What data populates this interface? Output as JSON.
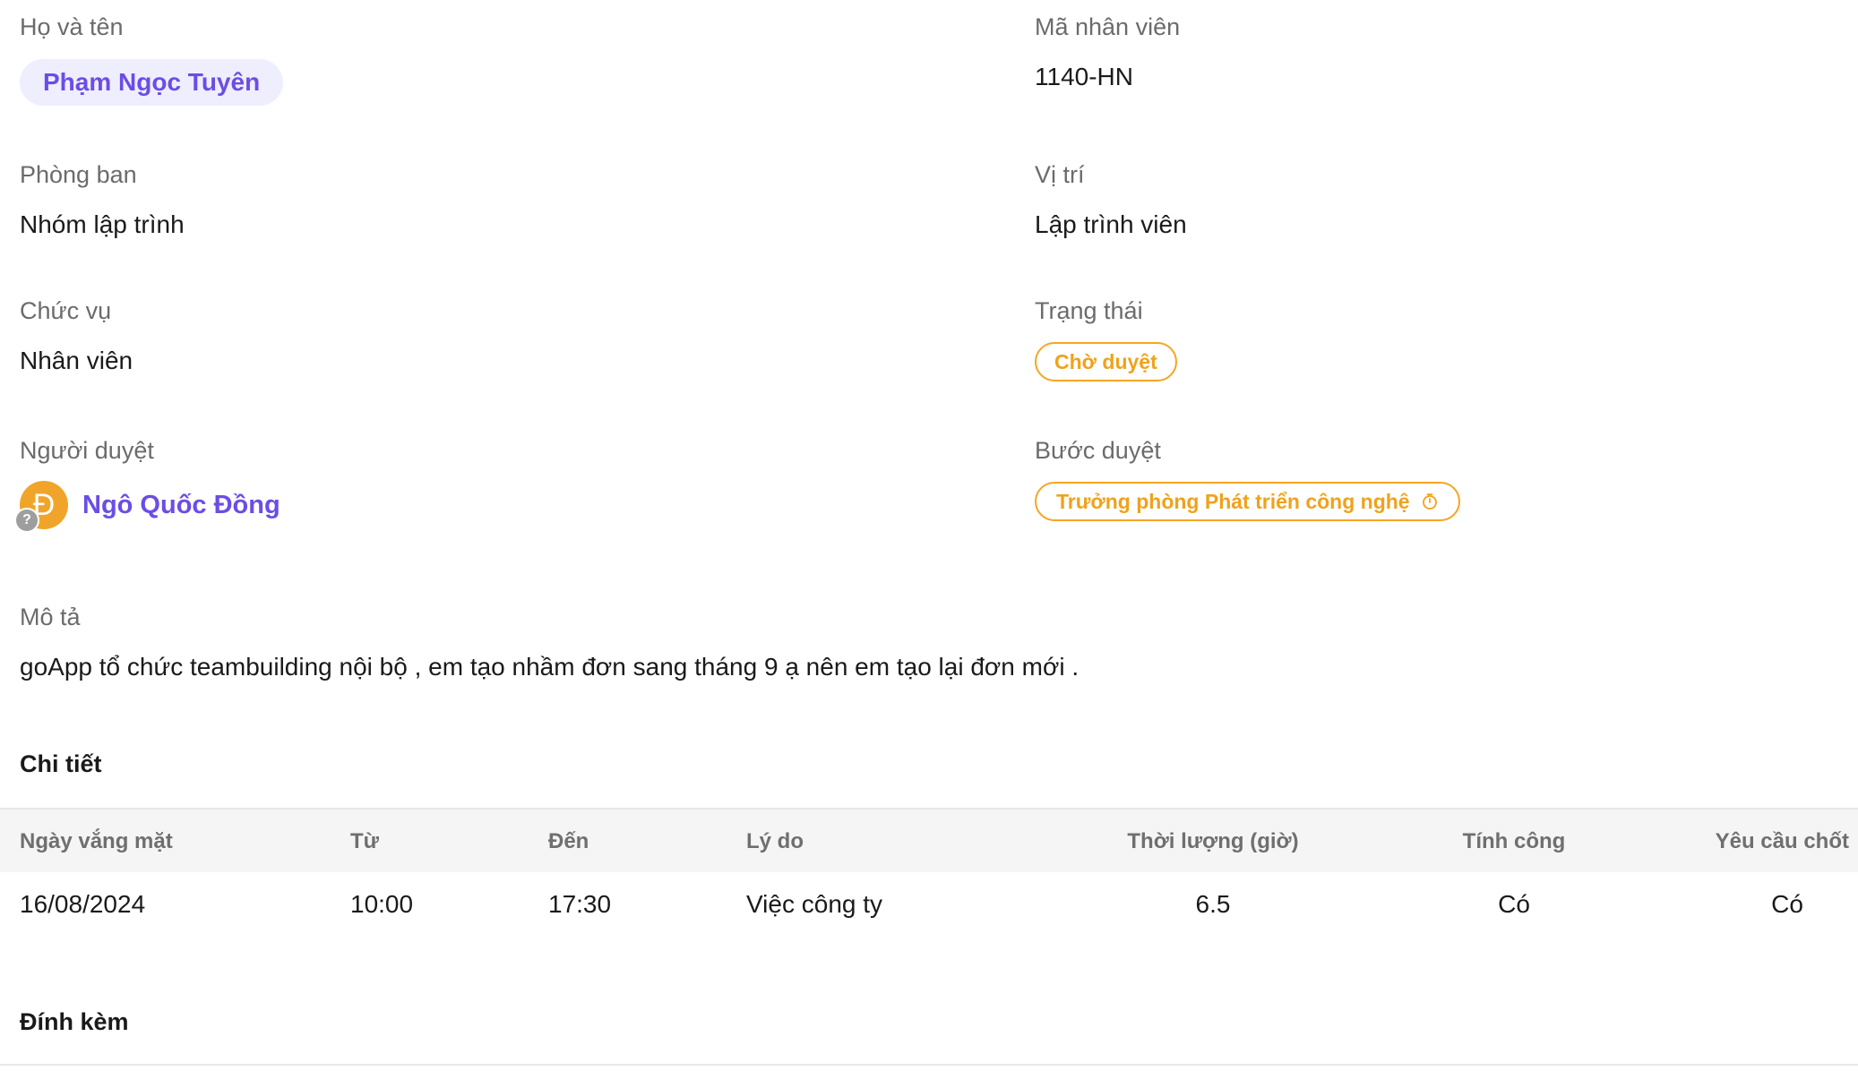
{
  "fields": {
    "full_name": {
      "label": "Họ và tên",
      "value": "Phạm Ngọc Tuyên"
    },
    "employee_code": {
      "label": "Mã nhân viên",
      "value": "1140-HN"
    },
    "department": {
      "label": "Phòng ban",
      "value": "Nhóm lập trình"
    },
    "position": {
      "label": "Vị trí",
      "value": "Lập trình viên"
    },
    "title": {
      "label": "Chức vụ",
      "value": "Nhân viên"
    },
    "status": {
      "label": "Trạng thái",
      "value": "Chờ duyệt"
    },
    "approver": {
      "label": "Người duyệt",
      "value": "Ngô Quốc Đồng",
      "avatar_initial": "Đ",
      "avatar_badge": "?"
    },
    "approval_step": {
      "label": "Bước duyệt",
      "value": "Trưởng phòng Phát triển công nghệ",
      "icon": "timer-icon"
    },
    "description": {
      "label": "Mô tả",
      "value": "goApp tổ chức teambuilding nội bộ , em tạo nhầm đơn sang tháng 9 ạ nên em tạo lại đơn mới ."
    }
  },
  "details": {
    "title": "Chi tiết",
    "columns": [
      "Ngày vắng mặt",
      "Từ",
      "Đến",
      "Lý do",
      "Thời lượng (giờ)",
      "Tính công",
      "Yêu cầu chốt"
    ],
    "rows": [
      [
        "16/08/2024",
        "10:00",
        "17:30",
        "Việc công ty",
        "6.5",
        "Có",
        "Có"
      ]
    ]
  },
  "attachments": {
    "title": "Đính kèm"
  },
  "colors": {
    "accent": "#6b4de6",
    "pending": "#f0a21b",
    "header_bg": "#f4f5f4"
  }
}
